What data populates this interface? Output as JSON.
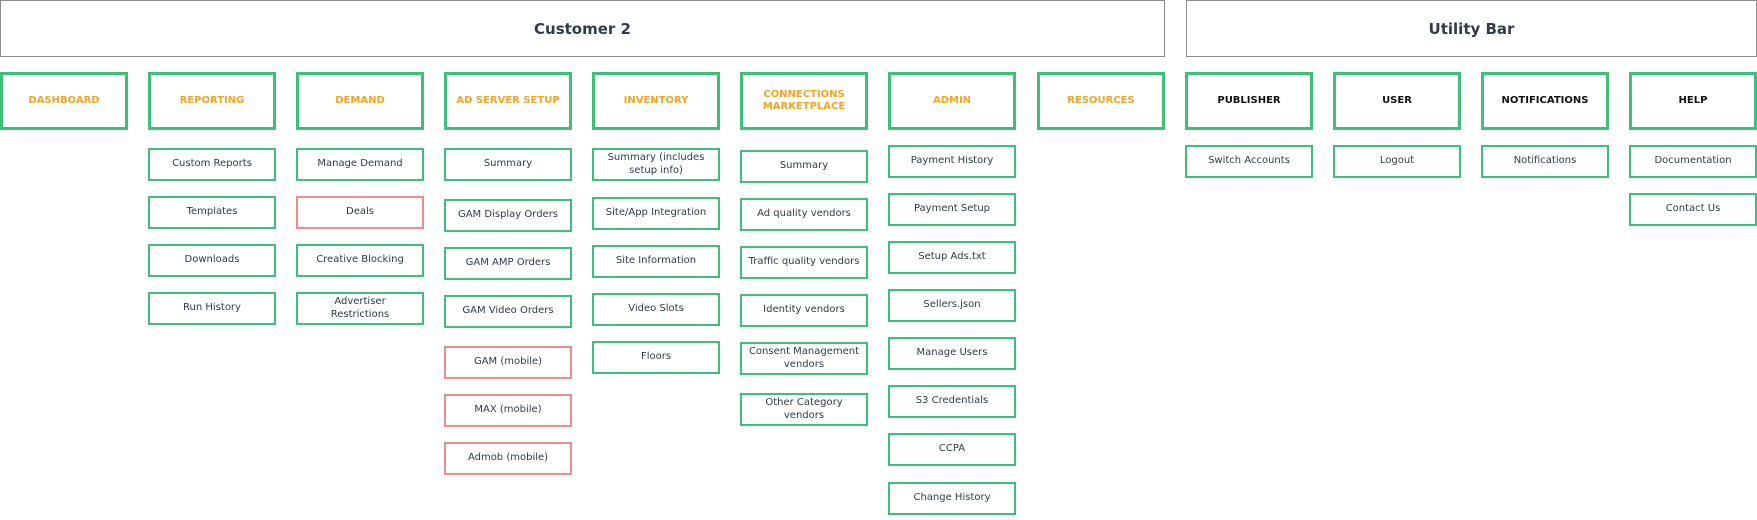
{
  "headers": {
    "customer": "Customer 2",
    "utility": "Utility Bar"
  },
  "menus": {
    "dashboard": {
      "label": "DASHBOARD"
    },
    "reporting": {
      "label": "REPORTING",
      "items": [
        "Custom Reports",
        "Templates",
        "Downloads",
        "Run History"
      ]
    },
    "demand": {
      "label": "DEMAND",
      "items": [
        "Manage Demand",
        "Deals",
        "Creative Blocking",
        "Advertiser Restrictions"
      ]
    },
    "ad_server_setup": {
      "label": "AD SERVER SETUP",
      "items": [
        "Summary",
        "GAM Display Orders",
        "GAM AMP Orders",
        "GAM Video Orders",
        "GAM (mobile)",
        "MAX (mobile)",
        "Admob (mobile)"
      ]
    },
    "inventory": {
      "label": "INVENTORY",
      "items": [
        "Summary (includes setup info)",
        "Site/App Integration",
        "Site Information",
        "Video Slots",
        "Floors"
      ]
    },
    "connections_marketplace": {
      "label": "CONNECTIONS MARKETPLACE",
      "items": [
        "Summary",
        "Ad quality vendors",
        "Traffic quality vendors",
        "Identity vendors",
        "Consent Management vendors",
        "Other Category vendors"
      ]
    },
    "admin": {
      "label": "ADMIN",
      "items": [
        "Payment History",
        "Payment Setup",
        "Setup Ads.txt",
        "Sellers.json",
        "Manage Users",
        "S3 Credentials",
        "CCPA",
        "Change History"
      ]
    },
    "resources": {
      "label": "RESOURCES"
    },
    "publisher": {
      "label": "PUBLISHER",
      "items": [
        "Switch Accounts"
      ]
    },
    "user": {
      "label": "USER",
      "items": [
        "Logout"
      ]
    },
    "notifications": {
      "label": "NOTIFICATIONS",
      "items": [
        "Notifications"
      ]
    },
    "help": {
      "label": "HELP",
      "items": [
        "Documentation",
        "Contact Us"
      ]
    }
  },
  "colors": {
    "box_border": "#3fc07a",
    "highlight_border": "#f28b8b",
    "nav_label": "#f5a51e",
    "utility_label": "#111111"
  }
}
